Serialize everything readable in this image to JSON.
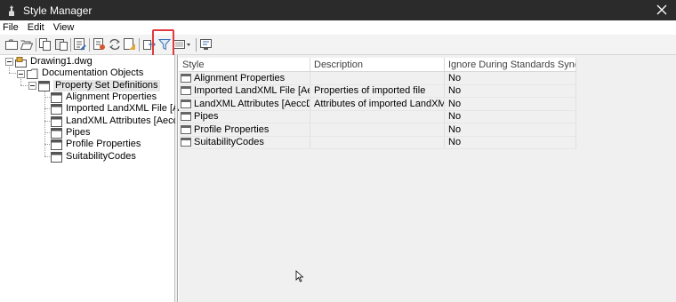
{
  "window": {
    "title": "Style Manager",
    "close_icon": "close-icon"
  },
  "menu": [
    "File",
    "Edit",
    "View"
  ],
  "toolbar": {
    "buttons": [
      "new-drawing-icon",
      "open-drawing-icon",
      "copy-icon",
      "paste-icon",
      "edit-style-icon",
      "purge-icon",
      "synchronize-icon",
      "update-standards-icon",
      "import-export-icon",
      "filter-icon",
      "view-options-dropdown-icon",
      "toggle-view-icon"
    ],
    "highlight_color": "#e0393e"
  },
  "tree": {
    "root": "Drawing1.dwg",
    "category": "Documentation Objects",
    "folder": "Property Set Definitions",
    "items": [
      "Alignment Properties",
      "Imported LandXML File [Aeccl",
      "LandXML Attributes [AeccDbS",
      "Pipes",
      "Profile Properties",
      "SuitabilityCodes"
    ]
  },
  "grid": {
    "columns": [
      "Style",
      "Description",
      "Ignore During Standards Synchro..."
    ],
    "rows": [
      {
        "style": "Alignment Properties",
        "description": "",
        "ignore": "No"
      },
      {
        "style": "Imported LandXML File [AeccD...",
        "description": "Properties of imported file",
        "ignore": "No"
      },
      {
        "style": "LandXML Attributes [AeccDbSu...",
        "description": "Attributes of imported LandXML e...",
        "ignore": "No"
      },
      {
        "style": "Pipes",
        "description": "",
        "ignore": "No"
      },
      {
        "style": "Profile Properties",
        "description": "",
        "ignore": "No"
      },
      {
        "style": "SuitabilityCodes",
        "description": "",
        "ignore": "No"
      }
    ]
  }
}
